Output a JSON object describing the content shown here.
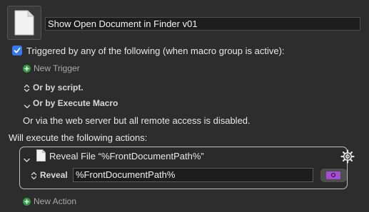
{
  "macro": {
    "name": "Show Open Document in Finder v01"
  },
  "triggers": {
    "checkbox_label": "Triggered by any of the following (when macro group is active):",
    "checked": true,
    "new_trigger_label": "New Trigger",
    "or_by_script_label": "Or by script.",
    "or_by_execute_macro_label": "Or by Execute Macro",
    "web_server_note": "Or via the web server but all remote access is disabled."
  },
  "actions": {
    "section_label": "Will execute the following actions:",
    "items": [
      {
        "title": "Reveal File “%FrontDocumentPath%”",
        "field_label": "Reveal",
        "field_value": "%FrontDocumentPath%"
      }
    ],
    "new_action_label": "New Action"
  },
  "colors": {
    "background": "#2d2d2d",
    "checkbox_accent": "#3478f6",
    "add_icon": "#2e9d43",
    "token_button": "#a24fd3"
  },
  "icons": [
    "document-icon",
    "checkbox-checked",
    "plus-circle-icon",
    "chevron-updown-icon",
    "chevron-down-icon",
    "gear-icon",
    "token-icon"
  ]
}
